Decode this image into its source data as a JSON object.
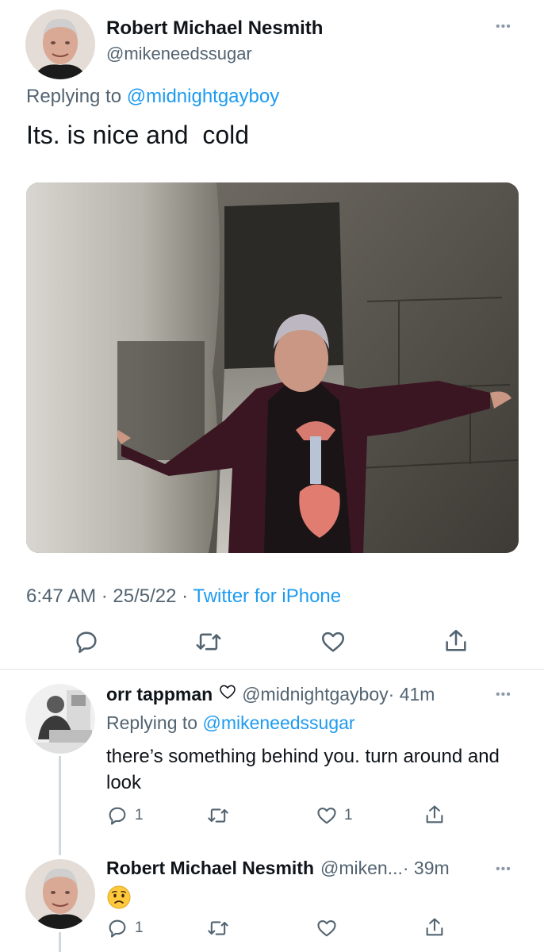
{
  "main_tweet": {
    "name": "Robert Michael Nesmith",
    "handle": "@mikeneedssugar",
    "replying_prefix": "Replying to ",
    "replying_to": "@midnightgayboy",
    "text": "Its. is nice and  cold",
    "timestamp": "6:47 AM · 25/5/22 · ",
    "source": "Twitter for iPhone",
    "more_icon": "ellipsis-icon"
  },
  "reply_1": {
    "name": "orr tappman",
    "name_icon": "heart-outline-icon",
    "handle": "@midnightgayboy",
    "time": " · 41m",
    "replying_prefix": "Replying to ",
    "replying_to": "@mikeneedssugar",
    "text": "there’s something behind you. turn around and look",
    "reply_count": "1",
    "like_count": "1"
  },
  "reply_2": {
    "name": "Robert Michael Nesmith",
    "handle": "@miken...",
    "time": " · 39m",
    "emoji": "worried-face-emoji",
    "reply_count": "1"
  },
  "colors": {
    "link": "#1d9bf0",
    "secondary_text": "#536471",
    "primary_text": "#0f1419",
    "divider": "#dfe3e6"
  }
}
